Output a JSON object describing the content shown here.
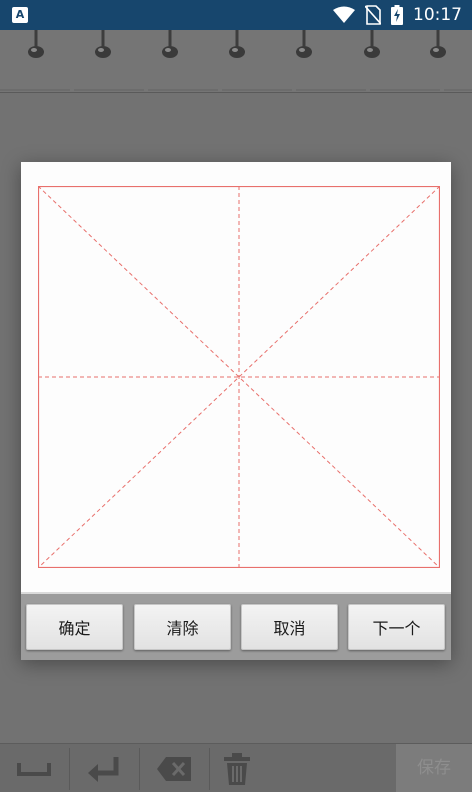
{
  "status_bar": {
    "time": "10:17",
    "app_icon_letter": "A",
    "icons": [
      "wifi-icon",
      "no-sim-icon",
      "battery-charging-icon"
    ]
  },
  "dialog": {
    "grid_style": "mi-zi-ge",
    "grid_color": "#e8706c",
    "buttons": {
      "confirm": "确定",
      "clear": "清除",
      "cancel": "取消",
      "next": "下一个"
    }
  },
  "toolbar": {
    "tools": [
      "space-icon",
      "enter-icon",
      "backspace-icon",
      "trash-icon"
    ],
    "save_label": "保存"
  },
  "colors": {
    "status_bar": "#17466d",
    "dim_overlay": "#6e6e6e",
    "dialog_button_bar": "#9c9c9c"
  }
}
